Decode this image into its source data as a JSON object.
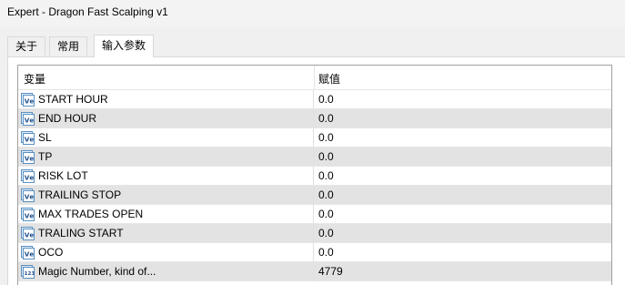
{
  "window": {
    "title": "Expert - Dragon Fast Scalping v1"
  },
  "tabs": [
    {
      "label": "关于"
    },
    {
      "label": "常用"
    },
    {
      "label": "输入参数"
    }
  ],
  "grid": {
    "columns": {
      "variable": "变量",
      "value": "赋值"
    },
    "rows": [
      {
        "icon": "double-value-icon",
        "name": "START HOUR",
        "value": "0.0"
      },
      {
        "icon": "double-value-icon",
        "name": "END HOUR",
        "value": "0.0"
      },
      {
        "icon": "double-value-icon",
        "name": "SL",
        "value": "0.0"
      },
      {
        "icon": "double-value-icon",
        "name": "TP",
        "value": "0.0"
      },
      {
        "icon": "double-value-icon",
        "name": "RISK LOT",
        "value": "0.0"
      },
      {
        "icon": "double-value-icon",
        "name": "TRAILING STOP",
        "value": "0.0"
      },
      {
        "icon": "double-value-icon",
        "name": "MAX TRADES OPEN",
        "value": "0.0"
      },
      {
        "icon": "double-value-icon",
        "name": "TRALING START",
        "value": "0.0"
      },
      {
        "icon": "double-value-icon",
        "name": "OCO",
        "value": "0.0"
      },
      {
        "icon": "integer-value-icon",
        "name": "Magic Number, kind of...",
        "value": "4779"
      }
    ]
  }
}
